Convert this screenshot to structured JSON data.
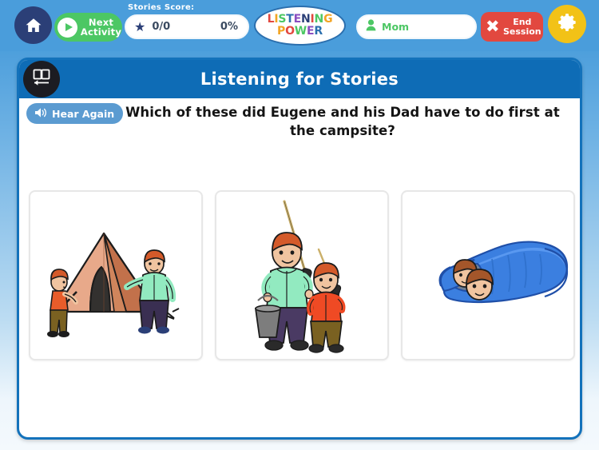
{
  "topbar": {
    "home_icon": "home-icon",
    "next_activity": {
      "line1": "Next",
      "line2": "Activity",
      "icon": "play-icon",
      "color": "#4cc764"
    },
    "score": {
      "label": "Stories Score:",
      "star_icon": "star-icon",
      "value": "0/0",
      "percent": "0%"
    },
    "logo": {
      "line1": "LISTENING",
      "line2": "POWER",
      "line1_letters": [
        {
          "ch": "L",
          "color": "#e2483f"
        },
        {
          "ch": "I",
          "color": "#f2a423"
        },
        {
          "ch": "S",
          "color": "#4cc764"
        },
        {
          "ch": "T",
          "color": "#2b6fae"
        },
        {
          "ch": "E",
          "color": "#8a4ec0"
        },
        {
          "ch": "N",
          "color": "#2b3f77"
        },
        {
          "ch": "I",
          "color": "#e2483f"
        },
        {
          "ch": "N",
          "color": "#4cc764"
        },
        {
          "ch": "G",
          "color": "#f2a423"
        }
      ],
      "line2_letters": [
        {
          "ch": "P",
          "color": "#f2a423"
        },
        {
          "ch": "O",
          "color": "#e2483f"
        },
        {
          "ch": "W",
          "color": "#4cc764"
        },
        {
          "ch": "E",
          "color": "#8a4ec0"
        },
        {
          "ch": "R",
          "color": "#2b6fae"
        }
      ]
    },
    "user": {
      "icon": "person-icon",
      "name": "Mom"
    },
    "end_session": {
      "icon": "close-x-icon",
      "line1": "End",
      "line2": "Session",
      "color": "#e2483f"
    },
    "settings_icon": "gear-icon"
  },
  "panel": {
    "book_icon": "book-back-icon",
    "title": "Listening for Stories",
    "hear_again": {
      "icon": "speaker-icon",
      "label": "Hear Again"
    },
    "question": "Which of these did Eugene and his Dad have to do first at the campsite?",
    "answers": [
      {
        "name": "answer-card-tent",
        "alt": "Boy and father putting up a tent at the campsite"
      },
      {
        "name": "answer-card-fishing",
        "alt": "Father and son holding fishing rods and a bucket"
      },
      {
        "name": "answer-card-sleeping-bag",
        "alt": "Father and son inside a blue sleeping bag"
      }
    ]
  },
  "colors": {
    "topbar_blue": "#4a9ddb",
    "panel_blue": "#0e6cb6",
    "panel_border": "#1372bb",
    "accent_green": "#4cc764",
    "accent_red": "#e2483f",
    "accent_yellow": "#f2c217"
  }
}
